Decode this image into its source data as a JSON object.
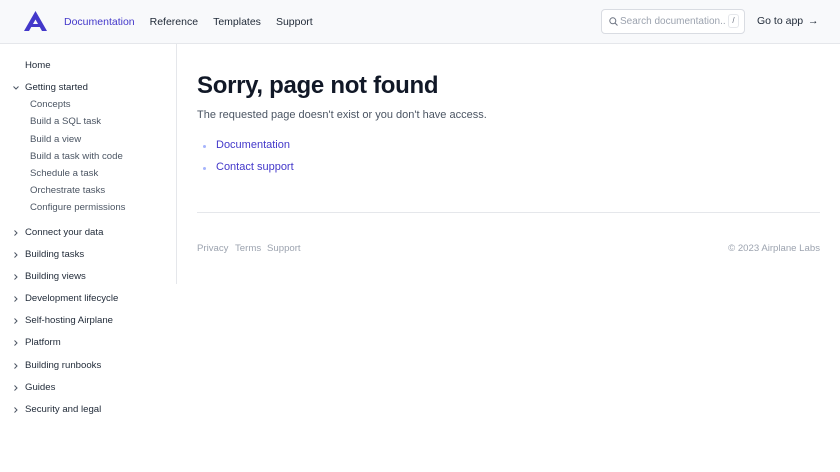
{
  "header": {
    "logo_alt": "Airplane",
    "nav": [
      {
        "label": "Documentation",
        "active": true
      },
      {
        "label": "Reference",
        "active": false
      },
      {
        "label": "Templates",
        "active": false
      },
      {
        "label": "Support",
        "active": false
      }
    ],
    "search": {
      "placeholder": "Search documentation...",
      "shortcut": "/"
    },
    "go_to_app": "Go to app"
  },
  "sidebar": {
    "home": "Home",
    "getting_started": {
      "label": "Getting started",
      "children": [
        "Concepts",
        "Build a SQL task",
        "Build a view",
        "Build a task with code",
        "Schedule a task",
        "Orchestrate tasks",
        "Configure permissions"
      ]
    },
    "sections": [
      "Connect your data",
      "Building tasks",
      "Building views",
      "Development lifecycle",
      "Self-hosting Airplane",
      "Platform",
      "Building runbooks",
      "Guides",
      "Security and legal"
    ]
  },
  "main": {
    "title": "Sorry, page not found",
    "description": "The requested page doesn't exist or you don't have access.",
    "links": [
      "Documentation",
      "Contact support"
    ]
  },
  "footer": {
    "links": [
      "Privacy",
      "Terms",
      "Support"
    ],
    "copyright": "© 2023 Airplane Labs"
  },
  "colors": {
    "accent": "#4338ca",
    "text": "#1f2937",
    "muted": "#9ca3af",
    "border": "#e5e7eb",
    "header_bg": "#f8f9fb"
  }
}
